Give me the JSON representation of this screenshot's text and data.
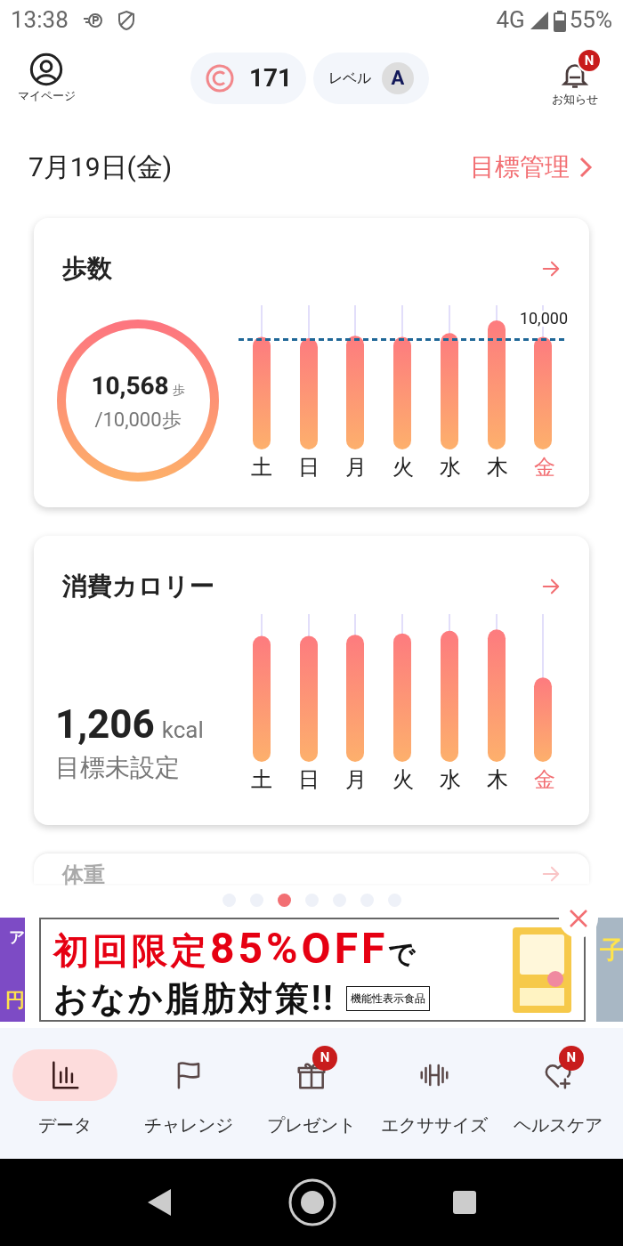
{
  "status_bar": {
    "time": "13:38",
    "network": "4G",
    "battery": "55%"
  },
  "header": {
    "profile_label": "マイページ",
    "coins": "171",
    "level_label": "レベル",
    "level_value": "A",
    "notifications_label": "お知らせ",
    "notification_badge": "N"
  },
  "date_row": {
    "date": "7月19日(金)",
    "goal_link": "目標管理"
  },
  "steps_card": {
    "title": "歩数",
    "value": "10,568",
    "unit": "歩",
    "goal": "/10,000歩",
    "goal_line_label": "10,000",
    "days": [
      {
        "label": "土",
        "selected": false
      },
      {
        "label": "日",
        "selected": false
      },
      {
        "label": "月",
        "selected": false
      },
      {
        "label": "火",
        "selected": false
      },
      {
        "label": "水",
        "selected": false
      },
      {
        "label": "木",
        "selected": false
      },
      {
        "label": "金",
        "selected": true
      }
    ]
  },
  "calorie_card": {
    "title": "消費カロリー",
    "value": "1,206",
    "unit": "kcal",
    "note": "目標未設定",
    "days": [
      {
        "label": "土",
        "selected": false
      },
      {
        "label": "日",
        "selected": false
      },
      {
        "label": "月",
        "selected": false
      },
      {
        "label": "火",
        "selected": false
      },
      {
        "label": "水",
        "selected": false
      },
      {
        "label": "木",
        "selected": false
      },
      {
        "label": "金",
        "selected": true
      }
    ]
  },
  "weight_card": {
    "title": "体重"
  },
  "pager": [
    {
      "selected": false
    },
    {
      "selected": false
    },
    {
      "selected": true
    },
    {
      "selected": false
    },
    {
      "selected": false
    },
    {
      "selected": false
    },
    {
      "selected": false
    }
  ],
  "ad": {
    "line1": "初回限定",
    "line1_highlight": "85%OFF",
    "line1_tail": "で",
    "line2": "おなか脂肪対策!!",
    "tag": "機能性表示食品",
    "left_peek": [
      "ア",
      "円"
    ],
    "right_peek": "子"
  },
  "bottom_nav": [
    {
      "label": "データ",
      "kind": "chart",
      "selected": true
    },
    {
      "label": "チャレンジ",
      "kind": "flag",
      "selected": false
    },
    {
      "label": "プレゼント",
      "kind": "gift",
      "selected": false,
      "badge": "N"
    },
    {
      "label": "エクササイズ",
      "kind": "dumbbell",
      "selected": false
    },
    {
      "label": "ヘルスケア",
      "kind": "heart",
      "selected": false,
      "badge": "N"
    }
  ]
}
